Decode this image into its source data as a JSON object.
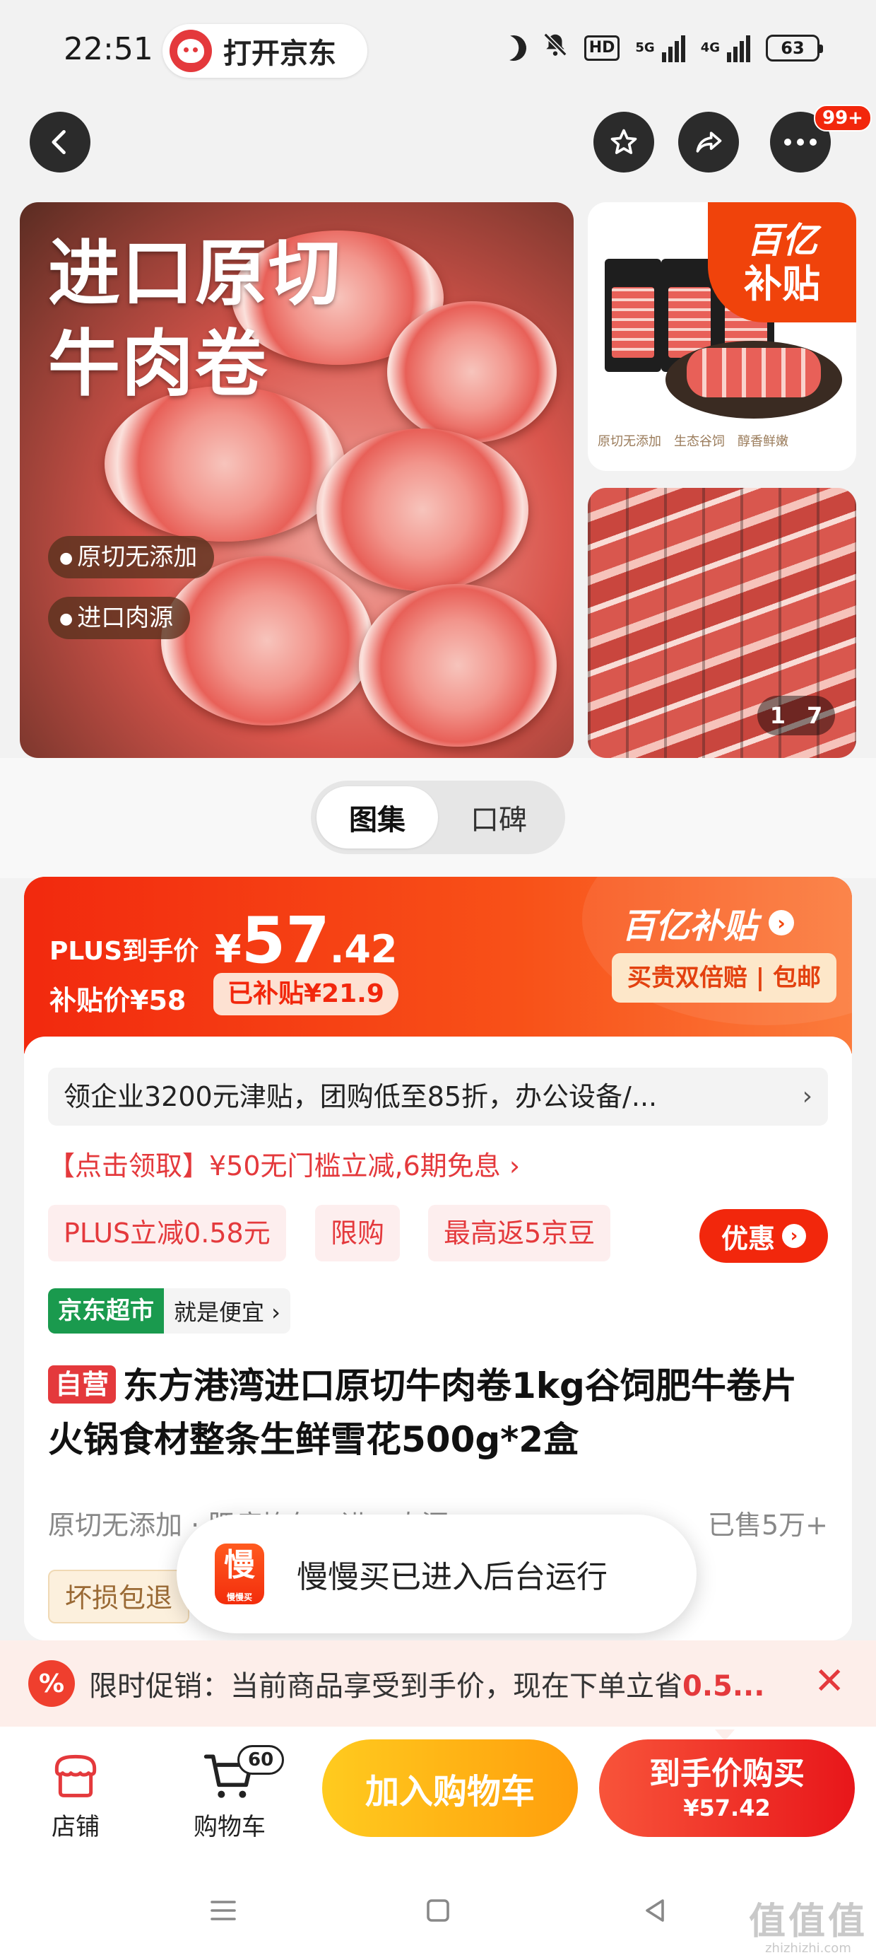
{
  "status_bar": {
    "time": "22:51",
    "app_pill_label": "打开京东",
    "hd_label": "HD",
    "net1": "5G",
    "net2": "4G",
    "battery": "63"
  },
  "nav": {
    "message_badge": "99+"
  },
  "gallery": {
    "main_headline_line1": "进口原切",
    "main_headline_line2": "牛肉卷",
    "main_tags": [
      "原切无添加",
      "进口肉源"
    ],
    "side_corner_line1": "百亿",
    "side_corner_line2": "补贴",
    "side_features": [
      "原切无添加",
      "生态谷饲",
      "醇香鲜嫩"
    ],
    "counter_current": "1",
    "counter_total": "7"
  },
  "tabs": [
    {
      "label": "图集",
      "active": true
    },
    {
      "label": "口碑",
      "active": false
    }
  ],
  "price": {
    "plus_label": "PLUS到手价",
    "currency": "¥",
    "plus_int": "57",
    "plus_dec": ".42",
    "subsidy_label": "补贴价¥58",
    "subsidy_chip": "已补贴¥21.9",
    "yi_logo": "百亿补贴",
    "yi_chip": "买贵双倍赔 | 包邮"
  },
  "offers": {
    "enterprise_text": "领企业3200元津贴，团购低至85折，办公设备/...",
    "coupon_text": "【点击领取】¥50无门槛立减,6期免息 ›",
    "chips": [
      "PLUS立减0.58元",
      "限购",
      "最高返5京豆"
    ],
    "youhui_label": "优惠"
  },
  "product": {
    "market_badge": "京东超市",
    "market_text": "就是便宜 ›",
    "self_badge": "自营",
    "title": "东方港湾进口原切牛肉卷1kg谷饲肥牛卷片火锅食材整条生鲜雪花500g*2盒",
    "features": "原切无添加 · 肥瘦均匀 · 进口肉源",
    "sold": "已售5万+",
    "guarantee": "坏损包退"
  },
  "toast": {
    "icon_char": "慢",
    "icon_small": "慢慢买",
    "text": "慢慢买已进入后台运行"
  },
  "promo_bar": {
    "icon": "%",
    "text_prefix": "限时促销：当前商品享受到手价，现在下单立省",
    "text_highlight": "0.5...",
    "close": "✕"
  },
  "bottom_bar": {
    "shop_label": "店铺",
    "cart_label": "购物车",
    "cart_count": "60",
    "add_cart_label": "加入购物车",
    "buy_label": "到手价购买",
    "buy_price": "¥57.42"
  },
  "watermark": {
    "big": "值值值",
    "small": "zhizhizhi.com"
  },
  "colors": {
    "accent": "#f2270c",
    "orange": "#f85118",
    "cart_yellow": "#ffb11a",
    "green_badge": "#1a9a4e"
  }
}
